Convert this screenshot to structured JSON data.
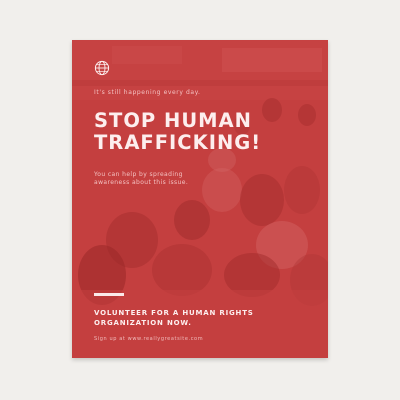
{
  "poster": {
    "eyebrow": "It's still happening every day.",
    "headline_line1": "STOP HUMAN",
    "headline_line2": "TRAFFICKING!",
    "subtext": "You can help by spreading awareness about this issue.",
    "cta_line1": "VOLUNTEER FOR A HUMAN RIGHTS",
    "cta_line2": "ORGANIZATION NOW.",
    "signup": "Sign up at www.reallygreatsite.com",
    "icon": "globe-icon"
  },
  "colors": {
    "background": "#f1efec",
    "poster_red": "#c43f3f",
    "text_light": "#fdeeee"
  }
}
